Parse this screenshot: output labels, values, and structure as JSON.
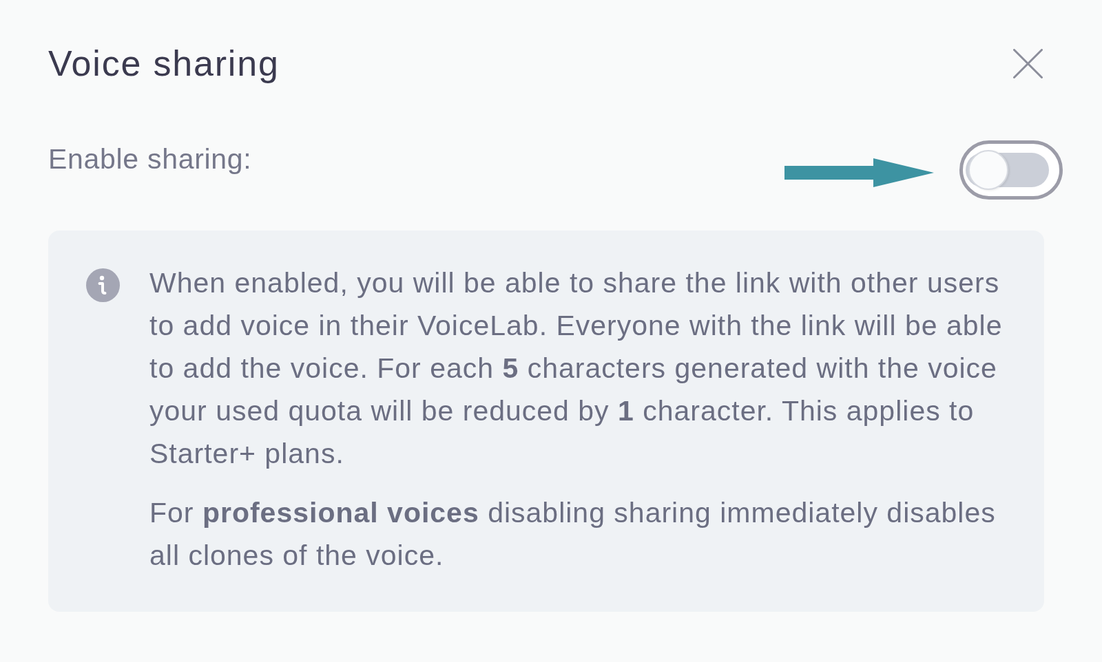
{
  "dialog": {
    "title": "Voice sharing"
  },
  "setting": {
    "label": "Enable sharing:",
    "on": false
  },
  "info": {
    "paragraphs": [
      "When enabled, you will be able to share the link with other users to add voice in their VoiceLab. Everyone with the link will be able to add the voice. For each **5** characters generated with the voice your used quota will be reduced by **1** character. This applies to Starter+ plans.",
      "For **professional voices** disabling sharing immediately disables all clones of the voice."
    ]
  }
}
